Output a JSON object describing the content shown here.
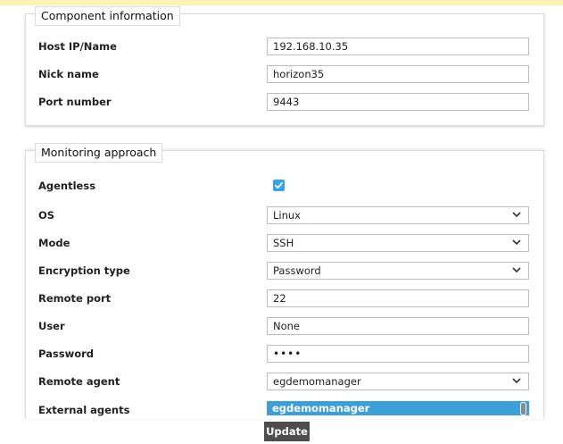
{
  "component_info": {
    "legend": "Component information",
    "host_label": "Host IP/Name",
    "host_value": "192.168.10.35",
    "nick_label": "Nick name",
    "nick_value": "horizon35",
    "port_label": "Port number",
    "port_value": "9443"
  },
  "monitoring": {
    "legend": "Monitoring approach",
    "agentless_label": "Agentless",
    "agentless_checked": true,
    "os_label": "OS",
    "os_value": "Linux",
    "mode_label": "Mode",
    "mode_value": "SSH",
    "encryption_label": "Encryption type",
    "encryption_value": "Password",
    "remote_port_label": "Remote port",
    "remote_port_value": "22",
    "user_label": "User",
    "user_value": "None",
    "password_label": "Password",
    "password_value": "••••",
    "remote_agent_label": "Remote agent",
    "remote_agent_value": "egdemomanager",
    "external_agents_label": "External agents",
    "external_agents_selected": "egdemomanager"
  },
  "update_label": "Update",
  "colors": {
    "accent": "#3aa3e3",
    "selection": "#3d9fd8",
    "button": "#4d4d4d",
    "top_banner": "#fbf3b5"
  },
  "icons": [
    "checkbox-checked-icon",
    "chevron-down-icon"
  ]
}
